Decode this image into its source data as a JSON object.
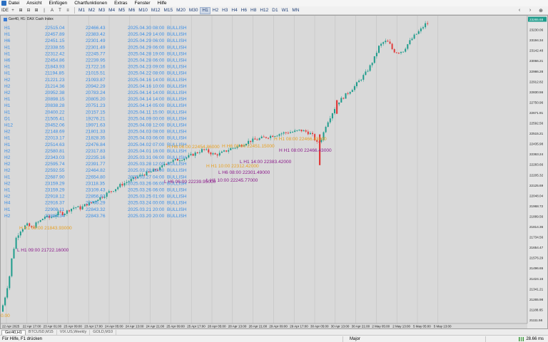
{
  "menu": [
    "Datei",
    "Ansicht",
    "Einfügen",
    "Chartfunktionen",
    "Extras",
    "Fenster",
    "Hilfe"
  ],
  "toolbar": {
    "buttons": [
      "IDE",
      "+",
      "⊞",
      "⊟",
      "⊞",
      "|",
      "A",
      "T",
      "≡"
    ],
    "timeframes": [
      "M1",
      "M2",
      "M3",
      "M4",
      "M5",
      "M6",
      "M10",
      "M12",
      "M15",
      "M20",
      "M30",
      "H1",
      "H2",
      "H3",
      "H4",
      "H6",
      "H8",
      "H12",
      "D1",
      "W1",
      "MN"
    ],
    "active_timeframe": "H1",
    "right_icons": [
      "‹",
      "›",
      "⊕"
    ]
  },
  "chart": {
    "title": "Ger40, H1:  DAX Cash Index",
    "price_labels": [
      "23265.68",
      "23230.06",
      "23194.34",
      "23142.48",
      "23066.21",
      "22986.28",
      "22912.82",
      "22830.56",
      "22750.96",
      "22671.91",
      "22592.56",
      "22515.21",
      "22435.98",
      "22363.24",
      "22283.66",
      "22205.32",
      "22125.69",
      "22048.04",
      "21968.72",
      "21889.56",
      "21814.36",
      "21734.56",
      "21654.47",
      "21576.29",
      "21496.65",
      "21424.16",
      "21341.21",
      "21265.98",
      "21188.65",
      "21111.56"
    ],
    "current_price": "23265.68",
    "time_labels": [
      "22 Apr 2025",
      "22 Apr 17:00",
      "23 Apr 01:00",
      "23 Apr 09:00",
      "23 Apr 17:00",
      "24 Apr 05:00",
      "24 Apr 13:00",
      "24 Apr 21:00",
      "25 Apr 09:00",
      "25 Apr 17:00",
      "28 Apr 05:00",
      "28 Apr 13:00",
      "28 Apr 21:00",
      "29 Apr 09:00",
      "29 Apr 17:00",
      "30 Apr 05:00",
      "30 Apr 13:00",
      "30 Apr 21:00",
      "2 May 05:00",
      "2 May 13:00",
      "5 May 05:00",
      "5 May 13:00"
    ],
    "table_rows": [
      [
        "H1",
        "22515.04",
        "22466.43",
        "2025.04.30 08:00",
        "BULLISH"
      ],
      [
        "H1",
        "22457.89",
        "22383.42",
        "2025.04.29 14:00",
        "BULLISH"
      ],
      [
        "H6",
        "22451.15",
        "22301.49",
        "2025.04.29 06:00",
        "BULLISH"
      ],
      [
        "H1",
        "22338.55",
        "22301.49",
        "2025.04.29 06:00",
        "BULLISH"
      ],
      [
        "H1",
        "22312.42",
        "22245.77",
        "2025.04.28 19:00",
        "BULLISH"
      ],
      [
        "H6",
        "22454.86",
        "22239.95",
        "2025.04.28 06:00",
        "BULLISH"
      ],
      [
        "H1",
        "21843.93",
        "21722.16",
        "2025.04.23 09:00",
        "BULLISH"
      ],
      [
        "H1",
        "21194.85",
        "21015.51",
        "2025.04.22 08:00",
        "BULLISH"
      ],
      [
        "H2",
        "21221.23",
        "21093.87",
        "2025.04.16 14:00",
        "BULLISH"
      ],
      [
        "H2",
        "21214.36",
        "20942.29",
        "2025.04.16 10:00",
        "BULLISH"
      ],
      [
        "H2",
        "20952.38",
        "20783.24",
        "2025.04.14 14:00",
        "BULLISH"
      ],
      [
        "H1",
        "20898.15",
        "20805.20",
        "2025.04.14 14:00",
        "BULLISH"
      ],
      [
        "H1",
        "20838.28",
        "20751.23",
        "2025.04.14 05:00",
        "BULLISH"
      ],
      [
        "H1",
        "20400.22",
        "20157.15",
        "2025.04.11 15:00",
        "BULLISH"
      ],
      [
        "D1",
        "21505.41",
        "19276.21",
        "2025.04.09 00:00",
        "BULLISH"
      ],
      [
        "H12",
        "20452.06",
        "19971.63",
        "2025.04.08 12:00",
        "BULLISH"
      ],
      [
        "H2",
        "22148.69",
        "21801.33",
        "2025.04.03 08:00",
        "BULLISH"
      ],
      [
        "H1",
        "22013.17",
        "21828.35",
        "2025.04.03 06:00",
        "BULLISH"
      ],
      [
        "H1",
        "22514.63",
        "22476.84",
        "2025.04.02 07:00",
        "BULLISH"
      ],
      [
        "H2",
        "22580.81",
        "22317.83",
        "2025.04.01 16:00",
        "BULLISH"
      ],
      [
        "H2",
        "22343.03",
        "22235.16",
        "2025.03.31 06:00",
        "BULLISH"
      ],
      [
        "H2",
        "22595.74",
        "22391.77",
        "2025.03.28 12:00",
        "BULLISH"
      ],
      [
        "H2",
        "22592.55",
        "22464.82",
        "2025.03.28 08:00",
        "BULLISH"
      ],
      [
        "H1",
        "22687.90",
        "22654.80",
        "2025.03.27 04:00",
        "BULLISH"
      ],
      [
        "H2",
        "23159.29",
        "23118.35",
        "2025.03.26 06:00",
        "BULLISH"
      ],
      [
        "H1",
        "23159.29",
        "23109.43",
        "2025.03.26 06:00",
        "BULLISH"
      ],
      [
        "H2",
        "22918.12",
        "22856.97",
        "2025.03.25 01:00",
        "BULLISH"
      ],
      [
        "H4",
        "22916.37",
        "22795.29",
        "2025.03.24 00:00",
        "BULLISH"
      ],
      [
        "H1",
        "22908.11",
        "22843.32",
        "2025.03.21 20:00",
        "BULLISH"
      ],
      [
        "H2",
        "22884.34",
        "22843.76",
        "2025.03.20 20:00",
        "BULLISH"
      ]
    ],
    "annotations": [
      {
        "text": "H H1 08:00 22466.43000",
        "color": "#e8a020",
        "kind": "high"
      },
      {
        "text": "H H1 08:00 22466.43000",
        "color": "#8b1a8b",
        "kind": "low-label"
      },
      {
        "text": "H H6 06:00 22454.86000",
        "color": "#e8a020",
        "kind": "high"
      },
      {
        "text": "L H6 06:00 22239.95000",
        "color": "#8b1a8b",
        "kind": "low"
      },
      {
        "text": "H H1 10:00 22312.42000",
        "color": "#e8a020",
        "kind": "high"
      },
      {
        "text": "L H1 10:00 22245.77000",
        "color": "#8b1a8b",
        "kind": "low"
      },
      {
        "text": "L H1 14:00 22383.42000",
        "color": "#8b1a8b",
        "kind": "low"
      },
      {
        "text": "L H6 08:00 22301.49000",
        "color": "#8b1a8b",
        "kind": "low"
      },
      {
        "text": "H H6 06:00 22451.15000",
        "color": "#e8a020",
        "kind": "high"
      },
      {
        "text": "H H1 09:00 21843.93000",
        "color": "#e8a020",
        "kind": "high"
      },
      {
        "text": "L H1 09:00 21722.16000",
        "color": "#8b1a8b",
        "kind": "low"
      },
      {
        "text": "0.00",
        "color": "#e8a020",
        "kind": "high"
      }
    ],
    "colors": {
      "bull": "#1e9c8c",
      "bear": "#e03a3a",
      "table_text": "#3a8ee6",
      "grid": "#bdbdbd",
      "background": "#d9d9d9"
    }
  },
  "tabs": [
    "Ger40,H1",
    "BTCUSD,M15",
    "VIX.US,Weekly",
    "GOLD,M10"
  ],
  "active_tab": "Ger40,H1",
  "status": {
    "help": "Für Hilfe, F1 drücken",
    "profile": "Major",
    "traffic": "28.66 ms"
  }
}
